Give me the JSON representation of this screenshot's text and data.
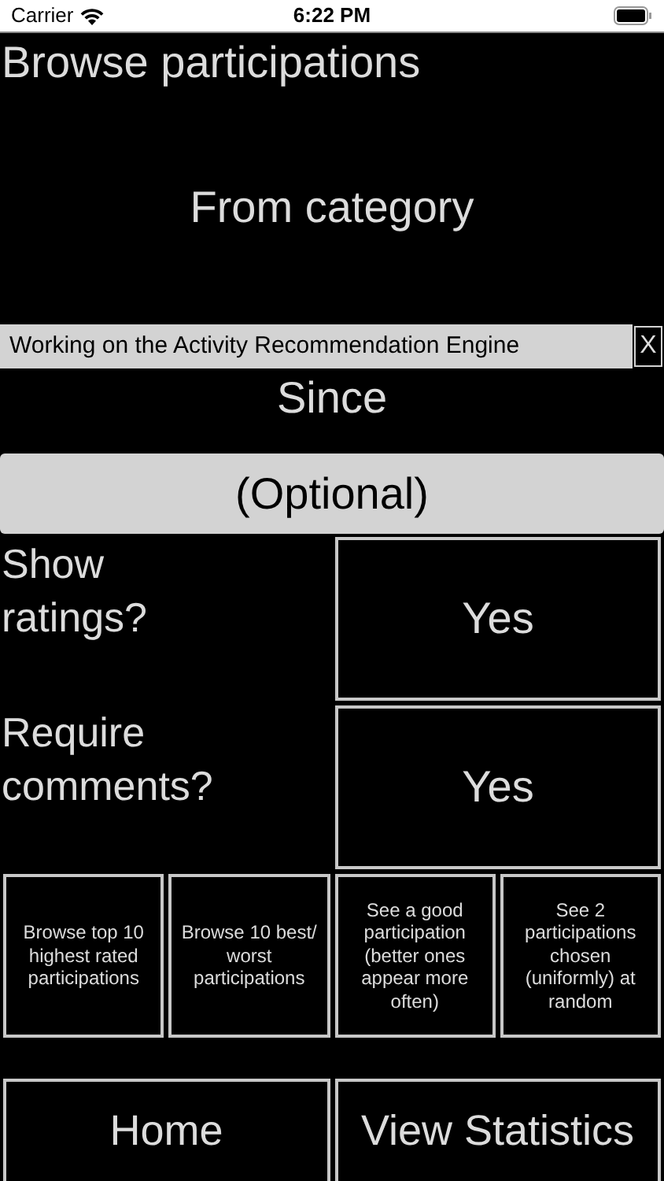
{
  "status_bar": {
    "carrier": "Carrier",
    "time": "6:22 PM"
  },
  "title": "Browse participations",
  "category_button": "From category",
  "banner": {
    "text": "Working on the Activity Recommendation Engine",
    "close": "X"
  },
  "since_button": "Since",
  "optional_button": "(Optional)",
  "options": [
    {
      "label": "Show ratings?",
      "value": "Yes"
    },
    {
      "label": "Require comments?",
      "value": "Yes"
    }
  ],
  "browse_buttons": [
    "Browse top 10 highest rated participations",
    "Browse 10 best/ worst participations",
    "See a good participation (better ones appear more often)",
    "See 2 participations chosen (uniformly) at random"
  ],
  "nav_buttons": [
    "Home",
    "View Statistics"
  ]
}
